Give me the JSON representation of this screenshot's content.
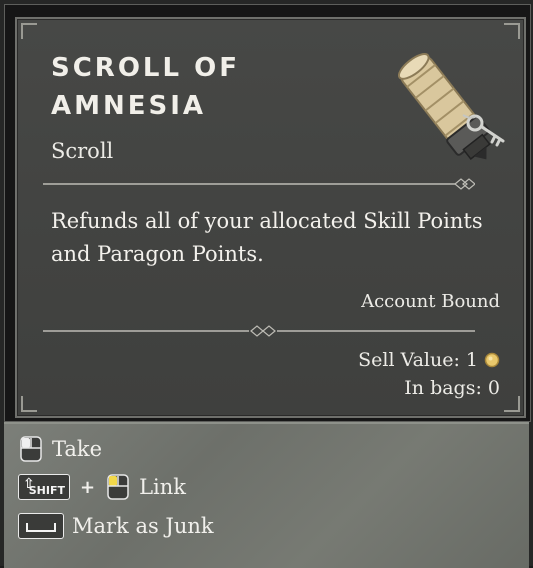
{
  "item": {
    "name_line1": "Scroll of",
    "name_line2": "Amnesia",
    "type": "Scroll",
    "description": "Refunds all of your allocated Skill Points and Paragon Points.",
    "binding": "Account Bound",
    "sell_value": "Sell Value: 1",
    "in_bags": "In bags: 0",
    "icon": "rolled-scroll-with-key-icon"
  },
  "actions": [
    {
      "label": "Take",
      "icon": "mouse-left-click-icon"
    },
    {
      "label": "Link",
      "key": "SHIFT",
      "plus": "+",
      "icon": "mouse-left-click-highlighted-icon"
    },
    {
      "label": "Mark as Junk",
      "icon": "spacebar-key-icon"
    }
  ],
  "colors": {
    "text": "#f1efe9",
    "panel": "#444543",
    "action_bar": "#737670",
    "coin": "#e9c86c"
  }
}
